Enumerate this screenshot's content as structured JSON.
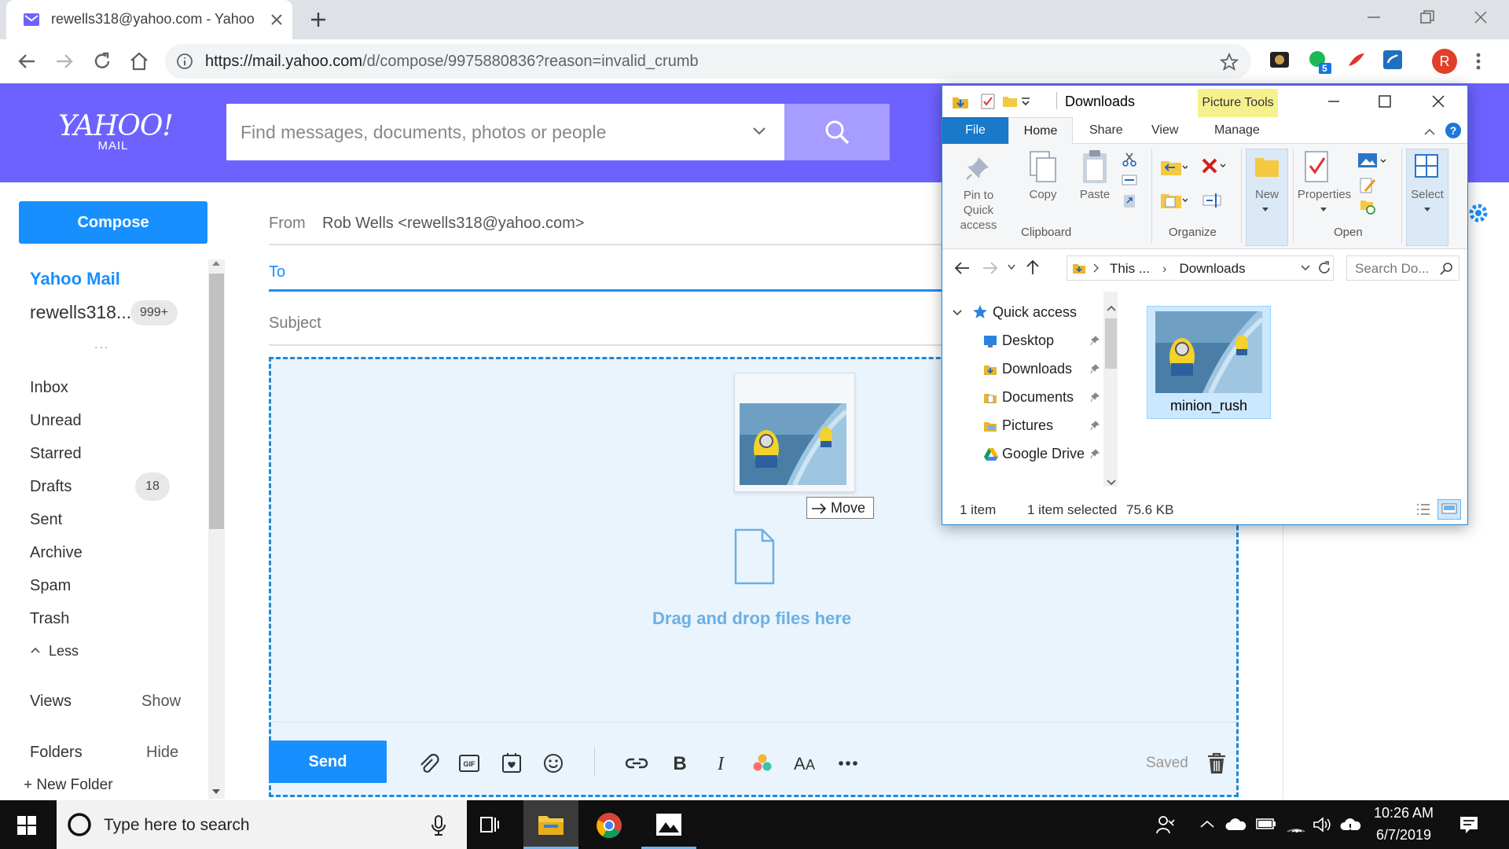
{
  "browser": {
    "tab_title": "rewells318@yahoo.com - Yahoo Mail",
    "new_tab_label": "+",
    "url_host": "https://mail.yahoo.com",
    "url_path": "/d/compose/9975880836?reason=invalid_crumb",
    "profile_initial": "R",
    "extension_badge": "5"
  },
  "yahoo": {
    "logo_main": "YAHOO!",
    "logo_sub": "MAIL",
    "search_placeholder": "Find messages, documents, photos or people"
  },
  "sidebar": {
    "compose_label": "Compose",
    "account_title": "Yahoo Mail",
    "account_email": "rewells318...",
    "account_badge": "999+",
    "account_more": "...",
    "folders": [
      {
        "label": "Inbox"
      },
      {
        "label": "Unread"
      },
      {
        "label": "Starred"
      },
      {
        "label": "Drafts",
        "count": "18"
      },
      {
        "label": "Sent"
      },
      {
        "label": "Archive"
      },
      {
        "label": "Spam"
      },
      {
        "label": "Trash"
      }
    ],
    "less_label": "Less",
    "views_label": "Views",
    "views_action": "Show",
    "folders_label": "Folders",
    "folders_action": "Hide",
    "new_folder_label": "+ New Folder"
  },
  "compose": {
    "from_label": "From",
    "from_value": "Rob Wells <rewells318@yahoo.com>",
    "to_label": "To",
    "subject_label": "Subject",
    "drop_text": "Drag and drop files here",
    "move_tooltip": "Move",
    "send_label": "Send",
    "saved_label": "Saved"
  },
  "explorer": {
    "title": "Downloads",
    "contextual_tab": "Picture Tools",
    "tabs": {
      "file": "File",
      "home": "Home",
      "share": "Share",
      "view": "View",
      "manage": "Manage"
    },
    "ribbon": {
      "pin_label": "Pin to Quick access",
      "copy_label": "Copy",
      "paste_label": "Paste",
      "new_label": "New",
      "properties_label": "Properties",
      "select_label": "Select",
      "group_clipboard": "Clipboard",
      "group_organize": "Organize",
      "group_open": "Open"
    },
    "address": {
      "part1": "This ...",
      "part2": "Downloads"
    },
    "search_placeholder": "Search Do...",
    "tree": [
      {
        "label": "Quick access"
      },
      {
        "label": "Desktop"
      },
      {
        "label": "Downloads"
      },
      {
        "label": "Documents"
      },
      {
        "label": "Pictures"
      },
      {
        "label": "Google Drive"
      }
    ],
    "file_name": "minion_rush",
    "status_count": "1 item",
    "status_selected": "1 item selected",
    "status_size": "75.6 KB"
  },
  "taskbar": {
    "search_placeholder": "Type here to search",
    "time": "10:26 AM",
    "date": "6/7/2019"
  },
  "colors": {
    "yahoo_purple": "#6e62ff",
    "accent_blue": "#188fff",
    "dropzone_bg": "#eaf4fd",
    "picture_tools": "#f6f18e"
  }
}
